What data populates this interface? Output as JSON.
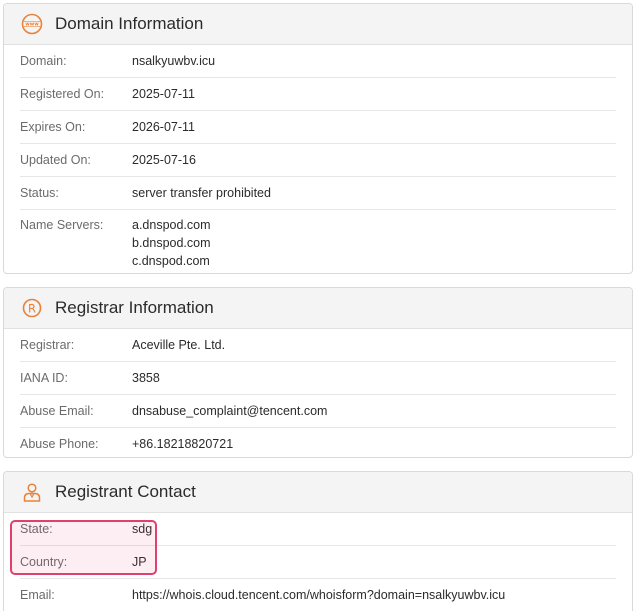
{
  "domain_info": {
    "title": "Domain Information",
    "icon": "www-globe-icon",
    "rows": [
      {
        "label": "Domain:",
        "value": "nsalkyuwbv.icu"
      },
      {
        "label": "Registered On:",
        "value": "2025-07-11"
      },
      {
        "label": "Expires On:",
        "value": "2026-07-11"
      },
      {
        "label": "Updated On:",
        "value": "2025-07-16"
      },
      {
        "label": "Status:",
        "value": "server transfer prohibited"
      }
    ],
    "name_servers": {
      "label": "Name Servers:",
      "values": [
        "a.dnspod.com",
        "b.dnspod.com",
        "c.dnspod.com"
      ]
    }
  },
  "registrar_info": {
    "title": "Registrar Information",
    "icon": "registered-mark-icon",
    "rows": [
      {
        "label": "Registrar:",
        "value": "Aceville Pte. Ltd."
      },
      {
        "label": "IANA ID:",
        "value": "3858"
      },
      {
        "label": "Abuse Email:",
        "value": "dnsabuse_complaint@tencent.com"
      },
      {
        "label": "Abuse Phone:",
        "value": "+86.18218820721"
      }
    ]
  },
  "registrant_contact": {
    "title": "Registrant Contact",
    "icon": "person-contact-icon",
    "rows": [
      {
        "label": "State:",
        "value": "sdg"
      },
      {
        "label": "Country:",
        "value": "JP"
      },
      {
        "label": "Email:",
        "value": "https://whois.cloud.tencent.com/whoisform?domain=nsalkyuwbv.icu"
      }
    ]
  },
  "colors": {
    "accent": "#e8823a",
    "highlight": "#e0406d"
  }
}
